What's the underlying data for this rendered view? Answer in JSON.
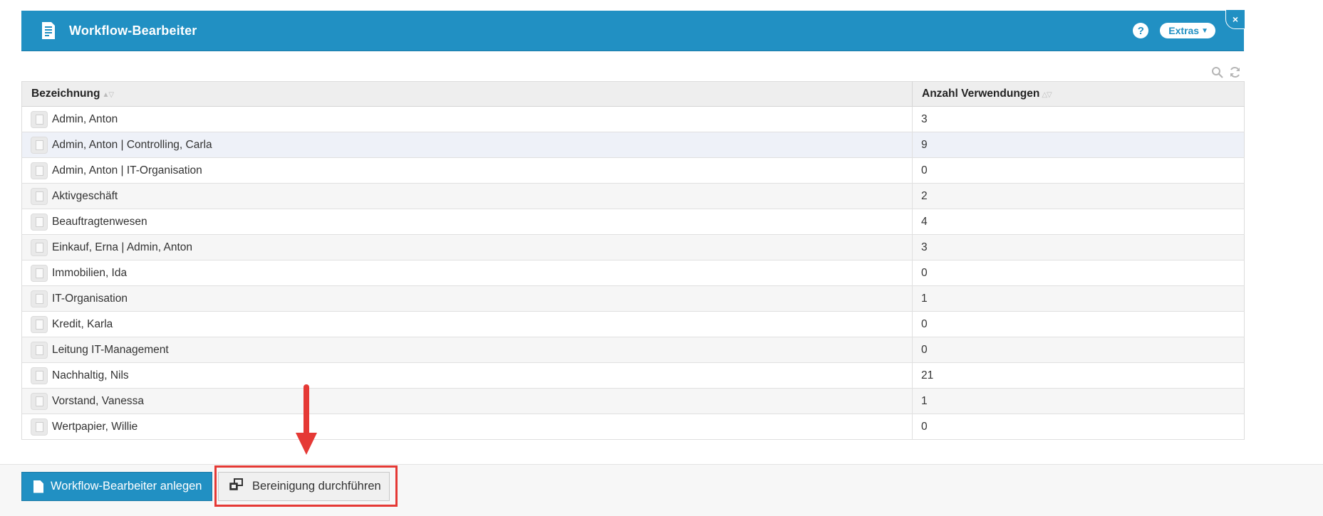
{
  "header": {
    "title": "Workflow-Bearbeiter",
    "help_label": "?",
    "extras_label": "Extras",
    "close_label": "×"
  },
  "table": {
    "columns": [
      "Bezeichnung",
      "Anzahl Verwendungen"
    ],
    "rows": [
      {
        "name": "Admin, Anton",
        "count": "3"
      },
      {
        "name": "Admin, Anton | Controlling, Carla",
        "count": "9"
      },
      {
        "name": "Admin, Anton | IT-Organisation",
        "count": "0"
      },
      {
        "name": "Aktivgeschäft",
        "count": "2"
      },
      {
        "name": "Beauftragtenwesen",
        "count": "4"
      },
      {
        "name": "Einkauf, Erna | Admin, Anton",
        "count": "3"
      },
      {
        "name": "Immobilien, Ida",
        "count": "0"
      },
      {
        "name": "IT-Organisation",
        "count": "1"
      },
      {
        "name": "Kredit, Karla",
        "count": "0"
      },
      {
        "name": "Leitung IT-Management",
        "count": "0"
      },
      {
        "name": "Nachhaltig, Nils",
        "count": "21"
      },
      {
        "name": "Vorstand, Vanessa",
        "count": "1"
      },
      {
        "name": "Wertpapier, Willie",
        "count": "0"
      }
    ],
    "highlighted_row_index": 1
  },
  "footer": {
    "create_button_label": "Workflow-Bearbeiter anlegen",
    "cleanup_button_label": "Bereinigung durchführen"
  },
  "colors": {
    "accent": "#2190c3",
    "annotation_red": "#e53935"
  },
  "icons": {
    "header": "document-icon",
    "row": "document-icon",
    "tools": [
      "search-icon",
      "refresh-icon"
    ]
  }
}
